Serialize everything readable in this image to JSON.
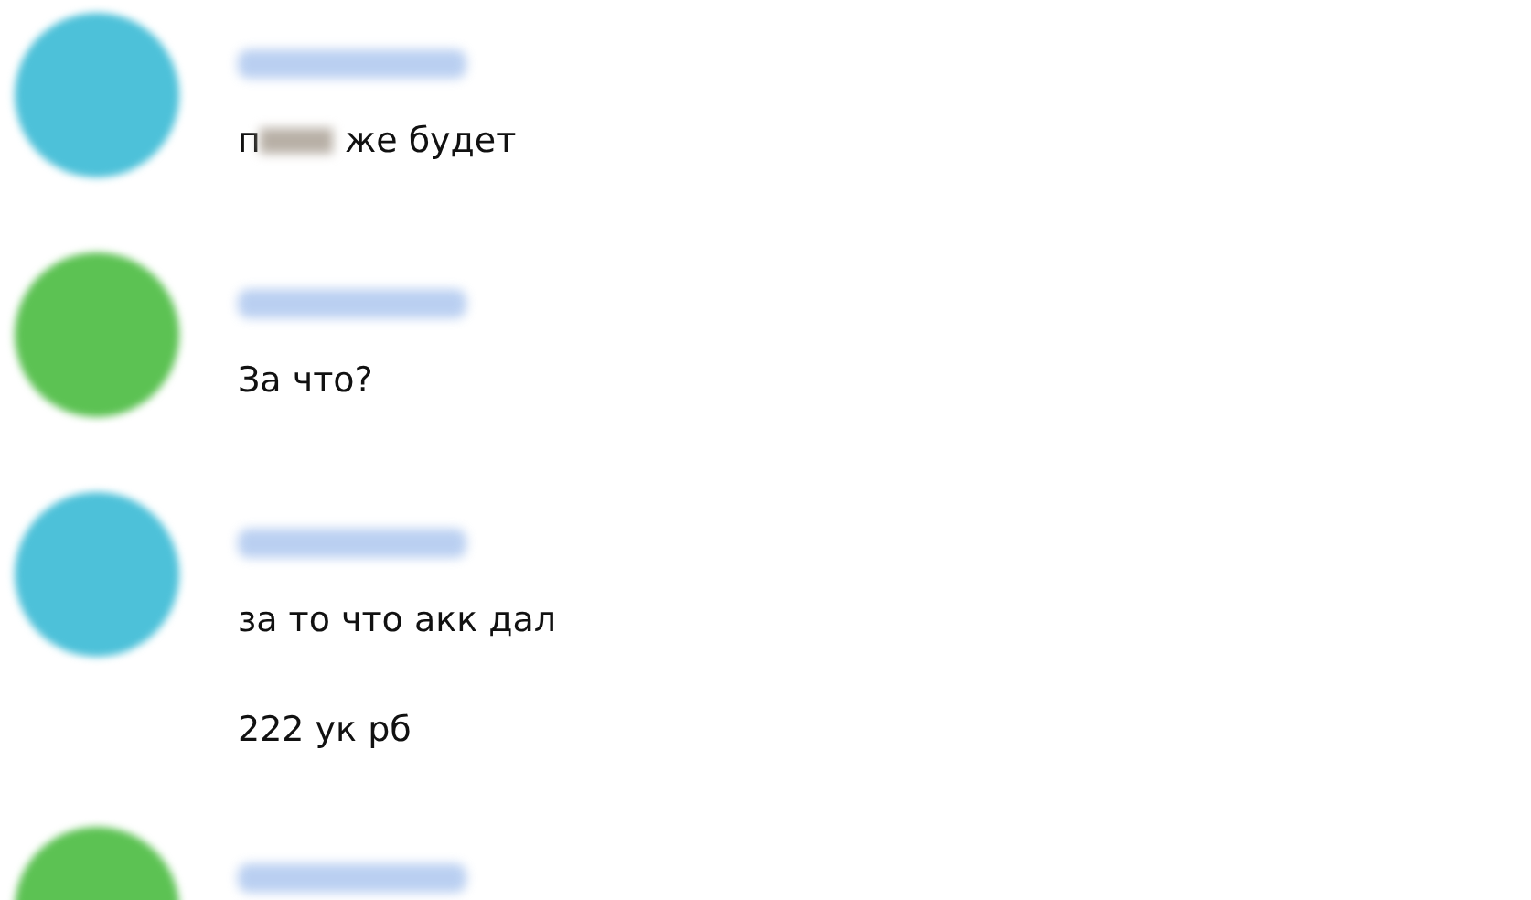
{
  "messages": [
    {
      "color": "#4dc1d9",
      "name_hidden": true,
      "lines": [
        {
          "before": "п",
          "censored": true,
          "after": " же будет"
        }
      ]
    },
    {
      "color": "#5cc253",
      "name_hidden": true,
      "lines": [
        {
          "before": "За что?",
          "censored": false
        }
      ]
    },
    {
      "color": "#4dc1d9",
      "name_hidden": true,
      "lines": [
        {
          "before": "за то что акк дал",
          "censored": false
        },
        {
          "before": "222 ук рб",
          "censored": false
        }
      ]
    },
    {
      "color": "#5cc253",
      "name_hidden": true
    }
  ]
}
